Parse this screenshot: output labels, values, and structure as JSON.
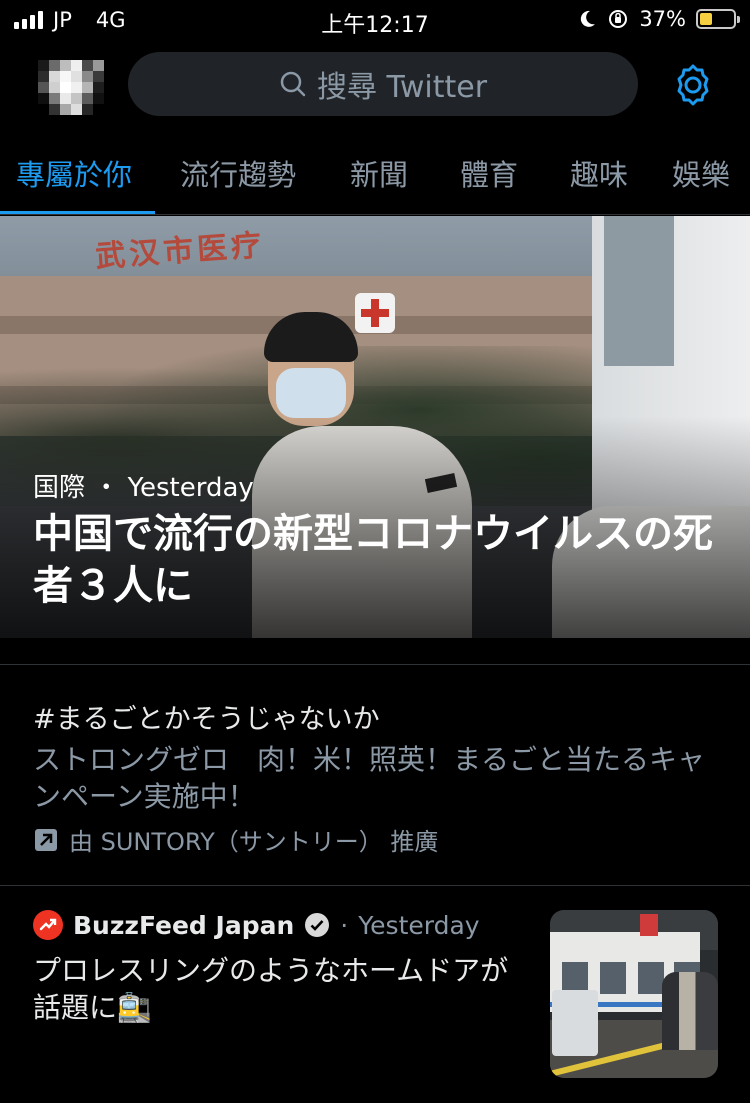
{
  "status_bar": {
    "carrier": "JP",
    "network": "4G",
    "time": "上午12:17",
    "battery_percent": "37%",
    "battery_level": 0.37,
    "battery_color": "#f5d142"
  },
  "header": {
    "search_placeholder": "搜尋 Twitter",
    "accent_color": "#1d9bf0",
    "icons": [
      "search-icon",
      "gear-icon"
    ]
  },
  "tabs": [
    {
      "label": "專屬於你",
      "active": true
    },
    {
      "label": "流行趨勢",
      "active": false
    },
    {
      "label": "新聞",
      "active": false
    },
    {
      "label": "體育",
      "active": false
    },
    {
      "label": "趣味",
      "active": false
    },
    {
      "label": "娛樂",
      "active": false
    }
  ],
  "hero": {
    "sign_text": "武汉市医疗",
    "category": "国際",
    "separator": "・",
    "time": "Yesterday",
    "title": "中国で流行の新型コロナウイルスの死者３人に"
  },
  "promoted": {
    "hashtag": "#まるごとかそうじゃないか",
    "description": "ストロングゼロ　肉！米！照英！まるごと当たるキャンペーン実施中！",
    "promoted_by": "由 SUNTORY（サントリー） 推廣"
  },
  "news_item": {
    "source": "BuzzFeed Japan",
    "separator": "·",
    "time": "Yesterday",
    "title": "プロレスリングのようなホームドアが話題に🚉",
    "brand_color": "#ee3322"
  }
}
